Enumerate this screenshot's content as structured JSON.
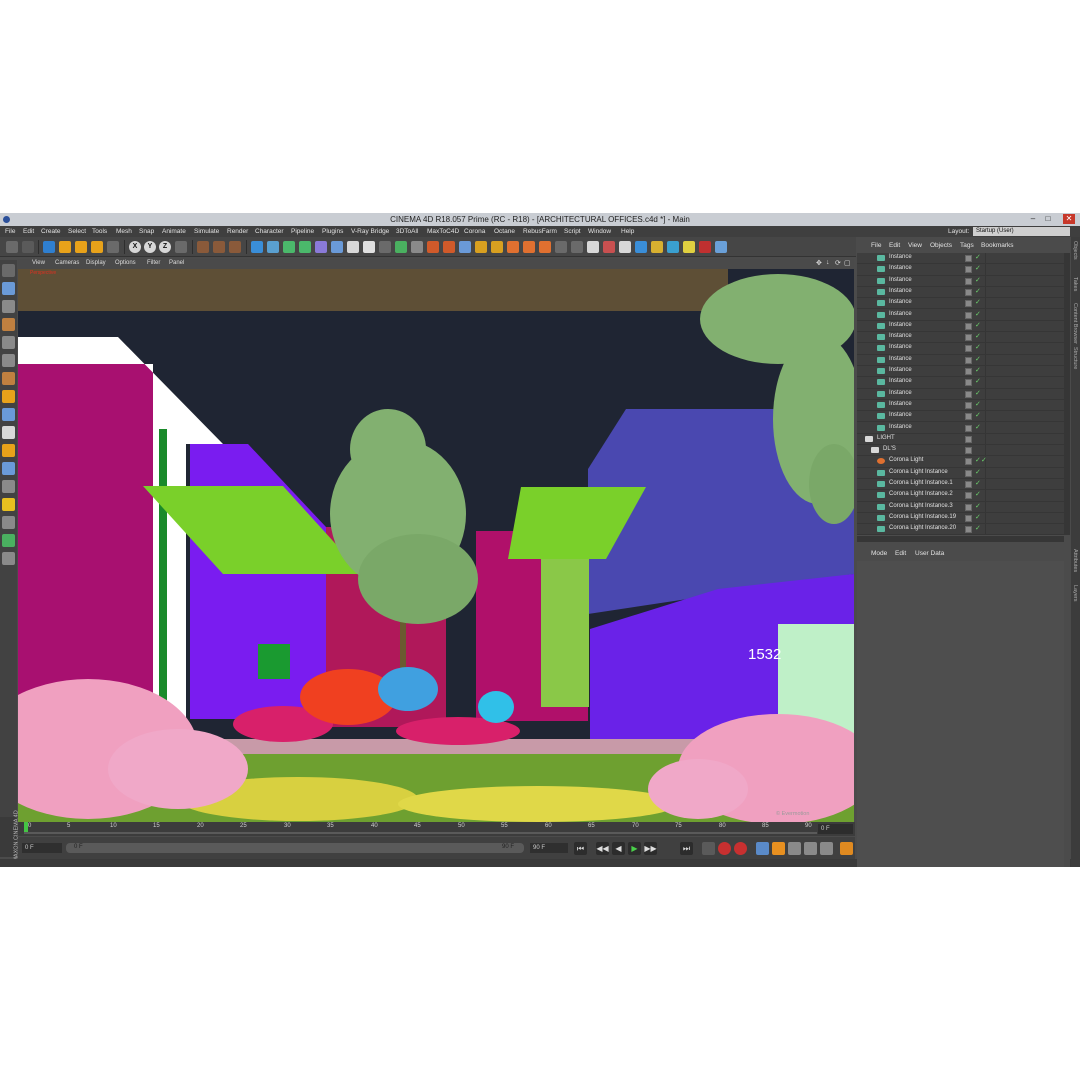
{
  "window": {
    "title": "CINEMA 4D R18.057 Prime (RC - R18) - [ARCHITECTURAL OFFICES.c4d *] - Main",
    "buttons": [
      "–",
      "□",
      "✕"
    ]
  },
  "menubar": {
    "items": [
      "File",
      "Edit",
      "Create",
      "Select",
      "Tools",
      "Mesh",
      "Snap",
      "Animate",
      "Simulate",
      "Render",
      "Character",
      "Pipeline",
      "Plugins",
      "V-Ray Bridge",
      "3DToAll",
      "MaxToC4D",
      "Corona",
      "Octane",
      "RebusFarm",
      "Script",
      "Window",
      "Help"
    ],
    "layout_label": "Layout:",
    "layout_value": "Startup (User)"
  },
  "toolbar": {
    "axis_buttons": [
      "X",
      "Y",
      "Z"
    ]
  },
  "viewport": {
    "menu": [
      "View",
      "Cameras",
      "Display",
      "Options",
      "Filter",
      "Panel"
    ],
    "nav_icons": [
      "move-view-icon",
      "zoom-view-icon",
      "rotate-view-icon",
      "maximize-view-icon"
    ],
    "nav_glyphs": [
      "✥",
      "↓",
      "⟳",
      "▢"
    ],
    "camera_label": "Perspective",
    "overlay_number": "1532",
    "watermark": "© Evermotion"
  },
  "timeline": {
    "ticks": [
      "0",
      "5",
      "10",
      "15",
      "20",
      "25",
      "30",
      "35",
      "40",
      "45",
      "50",
      "55",
      "60",
      "65",
      "70",
      "75",
      "80",
      "85",
      "90"
    ],
    "current_frame": "0 F"
  },
  "transport": {
    "start_field": "0 F",
    "slider_start": "0 F",
    "slider_end": "90 F",
    "end_field": "90 F",
    "buttons": [
      "⏮",
      "◀◀",
      "◀",
      "▶",
      "▶▶",
      "⏭"
    ]
  },
  "maxon": {
    "label": "MAXON CINEMA 4D"
  },
  "object_manager": {
    "menu": [
      "File",
      "Edit",
      "View",
      "Objects",
      "Tags",
      "Bookmarks"
    ],
    "rows": [
      {
        "name": "Instance",
        "type": "instance"
      },
      {
        "name": "Instance",
        "type": "instance"
      },
      {
        "name": "Instance",
        "type": "instance"
      },
      {
        "name": "Instance",
        "type": "instance"
      },
      {
        "name": "Instance",
        "type": "instance"
      },
      {
        "name": "Instance",
        "type": "instance"
      },
      {
        "name": "Instance",
        "type": "instance"
      },
      {
        "name": "Instance",
        "type": "instance"
      },
      {
        "name": "Instance",
        "type": "instance"
      },
      {
        "name": "Instance",
        "type": "instance"
      },
      {
        "name": "Instance",
        "type": "instance"
      },
      {
        "name": "Instance",
        "type": "instance"
      },
      {
        "name": "Instance",
        "type": "instance"
      },
      {
        "name": "Instance",
        "type": "instance"
      },
      {
        "name": "Instance",
        "type": "instance"
      },
      {
        "name": "Instance",
        "type": "instance"
      },
      {
        "name": "LIGHT",
        "type": "null"
      },
      {
        "name": "DL'S",
        "type": "null"
      },
      {
        "name": "Corona Light",
        "type": "light"
      },
      {
        "name": "Corona Light Instance",
        "type": "instance"
      },
      {
        "name": "Corona Light Instance.1",
        "type": "instance"
      },
      {
        "name": "Corona Light Instance.2",
        "type": "instance"
      },
      {
        "name": "Corona Light Instance.3",
        "type": "instance"
      },
      {
        "name": "Corona Light Instance.19",
        "type": "instance"
      },
      {
        "name": "Corona Light Instance.20",
        "type": "instance"
      }
    ]
  },
  "attribute_manager": {
    "menu": [
      "Mode",
      "Edit",
      "User Data"
    ]
  },
  "right_tabs": [
    "Objects",
    "Takes",
    "Content Browser",
    "Structure",
    "Attributes",
    "Layers"
  ],
  "colors": {
    "ui_bg": "#4b4b4b",
    "titlebar": "#c9cdd3",
    "close": "#c7382a",
    "checkmark": "#6bd16b"
  }
}
